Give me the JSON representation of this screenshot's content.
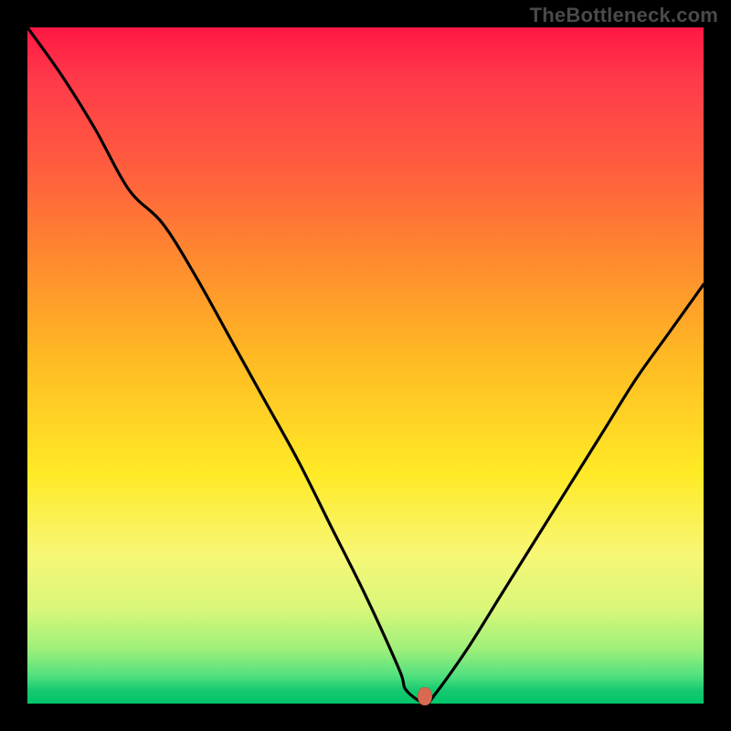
{
  "watermark": "TheBottleneck.com",
  "chart_data": {
    "type": "line",
    "title": "",
    "xlabel": "",
    "ylabel": "",
    "xlim": [
      0,
      100
    ],
    "ylim": [
      0,
      100
    ],
    "grid": false,
    "series": [
      {
        "name": "bottleneck-curve",
        "x": [
          0,
          5,
          10,
          15,
          20,
          25,
          30,
          35,
          40,
          45,
          50,
          55,
          56,
          58.8,
          60,
          65,
          70,
          75,
          80,
          85,
          90,
          95,
          100
        ],
        "values": [
          100,
          93,
          85,
          76,
          71,
          63,
          54,
          45,
          36,
          26,
          16,
          5,
          2,
          0,
          1,
          8,
          16,
          24,
          32,
          40,
          48,
          55,
          62
        ]
      }
    ],
    "marker": {
      "x": 58.8,
      "y": 0,
      "color": "#d96a50"
    },
    "gradient_background": {
      "top_color": "#ff1744",
      "bottom_color": "#00c56a"
    }
  }
}
